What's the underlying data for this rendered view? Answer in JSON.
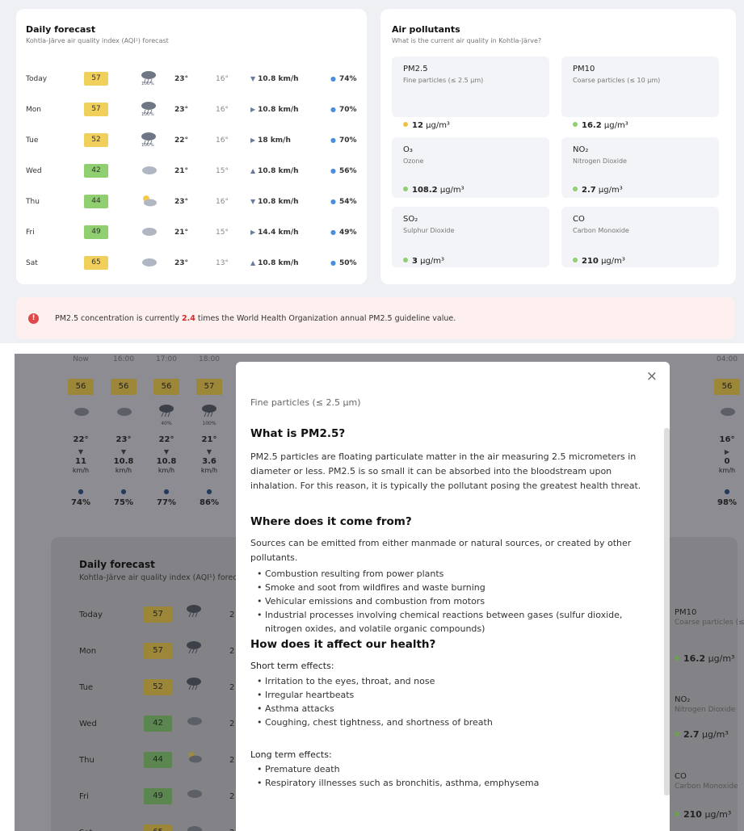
{
  "daily": {
    "title": "Daily forecast",
    "subtitle": "Kohtla-Järve air quality index (AQI¹) forecast",
    "rows": [
      {
        "day": "Today",
        "aqi": "57",
        "level": "moderate",
        "icon": "rain-cloud-icon",
        "pct": "100%",
        "hi": "23°",
        "lo": "16°",
        "dir": "▼",
        "wind": "10.8 km/h",
        "hum": "74%"
      },
      {
        "day": "Mon",
        "aqi": "57",
        "level": "moderate",
        "icon": "rain-cloud-icon",
        "pct": "100%",
        "hi": "23°",
        "lo": "16°",
        "dir": "▶",
        "wind": "10.8 km/h",
        "hum": "70%"
      },
      {
        "day": "Tue",
        "aqi": "52",
        "level": "moderate",
        "icon": "rain-cloud-icon",
        "pct": "100%",
        "hi": "22°",
        "lo": "16°",
        "dir": "▶",
        "wind": "18 km/h",
        "hum": "70%"
      },
      {
        "day": "Wed",
        "aqi": "42",
        "level": "good",
        "icon": "cloud-icon",
        "pct": "",
        "hi": "21°",
        "lo": "15°",
        "dir": "▲",
        "wind": "10.8 km/h",
        "hum": "56%"
      },
      {
        "day": "Thu",
        "aqi": "44",
        "level": "good",
        "icon": "partly-sunny-icon",
        "pct": "",
        "hi": "23°",
        "lo": "16°",
        "dir": "▼",
        "wind": "10.8 km/h",
        "hum": "54%"
      },
      {
        "day": "Fri",
        "aqi": "49",
        "level": "good",
        "icon": "cloud-icon",
        "pct": "",
        "hi": "21°",
        "lo": "15°",
        "dir": "▶",
        "wind": "14.4 km/h",
        "hum": "49%"
      },
      {
        "day": "Sat",
        "aqi": "65",
        "level": "moderate",
        "icon": "cloud-icon",
        "pct": "",
        "hi": "23°",
        "lo": "13°",
        "dir": "▲",
        "wind": "10.8 km/h",
        "hum": "50%"
      }
    ]
  },
  "pollutants": {
    "title": "Air pollutants",
    "subtitle": "What is the current air quality in Kohtla-Järve?",
    "items": [
      {
        "name": "PM2.5",
        "desc": "Fine particles (≤ 2.5 μm)",
        "value": "12",
        "unit": "μg/m³",
        "color": "#f0c043"
      },
      {
        "name": "PM10",
        "desc": "Coarse particles (≤ 10 μm)",
        "value": "16.2",
        "unit": "μg/m³",
        "color": "#8fcf6f"
      },
      {
        "name": "O₃",
        "desc": "Ozone",
        "value": "108.2",
        "unit": "μg/m³",
        "color": "#8fcf6f"
      },
      {
        "name": "NO₂",
        "desc": "Nitrogen Dioxide",
        "value": "2.7",
        "unit": "μg/m³",
        "color": "#8fcf6f"
      },
      {
        "name": "SO₂",
        "desc": "Sulphur Dioxide",
        "value": "3",
        "unit": "μg/m³",
        "color": "#8fcf6f"
      },
      {
        "name": "CO",
        "desc": "Carbon Monoxide",
        "value": "210",
        "unit": "μg/m³",
        "color": "#8fcf6f"
      }
    ]
  },
  "alert": {
    "pre": "PM2.5 concentration is currently ",
    "value": "2.4",
    "post": " times the World Health Organization annual PM2.5 guideline value."
  },
  "hourly": [
    {
      "time": "Now",
      "aqi": "56",
      "icon": "cloud-icon",
      "pct": "",
      "temp": "22°",
      "wind": "11",
      "unit": "km/h",
      "hum": "74%"
    },
    {
      "time": "16:00",
      "aqi": "56",
      "icon": "cloud-icon",
      "pct": "",
      "temp": "23°",
      "wind": "10.8",
      "unit": "km/h",
      "hum": "75%"
    },
    {
      "time": "17:00",
      "aqi": "56",
      "icon": "rain-cloud-icon",
      "pct": "40%",
      "temp": "22°",
      "wind": "10.8",
      "unit": "km/h",
      "hum": "77%"
    },
    {
      "time": "18:00",
      "aqi": "57",
      "icon": "rain-cloud-icon",
      "pct": "100%",
      "temp": "21°",
      "wind": "3.6",
      "unit": "km/h",
      "hum": "86%"
    }
  ],
  "hourly_right": [
    {
      "time": "04:00",
      "aqi": "56",
      "temp": "16°",
      "wind": "0",
      "unit": "km/h",
      "hum": "98%"
    }
  ],
  "modal": {
    "subtitle": "Fine particles (≤ 2.5 μm)",
    "h1": "What is PM2.5?",
    "p1": "PM2.5 particles are floating particulate matter in the air measuring 2.5 micrometers in diameter or less. PM2.5 is so small it can be absorbed into the bloodstream upon inhalation. For this reason, it is typically the pollutant posing the greatest health threat.",
    "h2": "Where does it come from?",
    "p2": "Sources can be emitted from either manmade or natural sources, or created by other pollutants.",
    "sources": [
      "Combustion resulting from power plants",
      "Smoke and soot from wildfires and waste burning",
      "Vehicular emissions and combustion from motors",
      "Industrial processes involving chemical reactions between gases (sulfur dioxide, nitrogen oxides, and volatile organic compounds)"
    ],
    "h3": "How does it affect our health?",
    "short_label": "Short term effects:",
    "short": [
      "Irritation to the eyes, throat, and nose",
      "Irregular heartbeats",
      "Asthma attacks",
      "Coughing, chest tightness, and shortness of breath"
    ],
    "long_label": "Long term effects:",
    "long": [
      "Premature death",
      "Respiratory illnesses such as bronchitis, asthma, emphysema"
    ],
    "close": "×"
  }
}
